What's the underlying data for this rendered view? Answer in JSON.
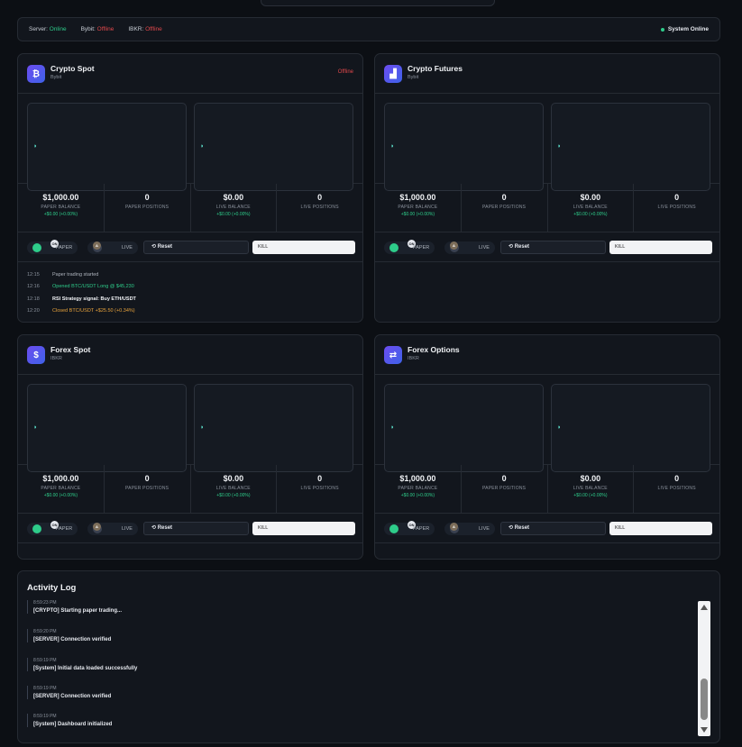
{
  "status_bar": {
    "server_label": "Server:",
    "server_value": "Online",
    "bybit_label": "Bybit:",
    "bybit_value": "Offline",
    "ibkr_label": "IBKR:",
    "ibkr_value": "Offline",
    "system": "System Online"
  },
  "panels": [
    {
      "title": "Crypto Spot",
      "subtitle": "Bybit",
      "status": "Offline",
      "icon": "bitcoin-icon",
      "icon_glyph": "₿",
      "stats": [
        {
          "value": "$1,000.00",
          "label": "PAPER BALANCE",
          "change": "+$0.00 (+0.00%)"
        },
        {
          "value": "0",
          "label": "PAPER POSITIONS",
          "change": ""
        },
        {
          "value": "$0.00",
          "label": "LIVE BALANCE",
          "change": "+$0.00 (+0.00%)"
        },
        {
          "value": "0",
          "label": "LIVE POSITIONS",
          "change": ""
        }
      ],
      "paper_label": "PAPER",
      "paper_tag": "ON",
      "live_label": "LIVE",
      "live_tag": "A",
      "reset_label": "Reset",
      "kill_label": "KILL",
      "trades": [
        {
          "time": "12:15",
          "text": "Paper trading started"
        },
        {
          "time": "12:16",
          "text": "Opened BTC/USDT Long @ $45,230"
        },
        {
          "time": "12:18",
          "text": "RSI Strategy signal: Buy ETH/USDT"
        },
        {
          "time": "12:20",
          "text": "Closed BTC/USDT +$25.50 (+0.34%)"
        }
      ]
    },
    {
      "title": "Crypto Futures",
      "subtitle": "Bybit",
      "status": "",
      "icon": "bar-chart-icon",
      "icon_glyph": "▟",
      "stats": [
        {
          "value": "$1,000.00",
          "label": "PAPER BALANCE",
          "change": "+$0.00 (+0.00%)"
        },
        {
          "value": "0",
          "label": "PAPER POSITIONS",
          "change": ""
        },
        {
          "value": "$0.00",
          "label": "LIVE BALANCE",
          "change": "+$0.00 (+0.00%)"
        },
        {
          "value": "0",
          "label": "LIVE POSITIONS",
          "change": ""
        }
      ],
      "paper_label": "PAPER",
      "paper_tag": "ON",
      "live_label": "LIVE",
      "live_tag": "A",
      "reset_label": "Reset",
      "kill_label": "KILL"
    },
    {
      "title": "Forex Spot",
      "subtitle": "IBKR",
      "status": "",
      "icon": "dollar-icon",
      "icon_glyph": "$",
      "stats": [
        {
          "value": "$1,000.00",
          "label": "PAPER BALANCE",
          "change": "+$0.00 (+0.00%)"
        },
        {
          "value": "0",
          "label": "PAPER POSITIONS",
          "change": ""
        },
        {
          "value": "$0.00",
          "label": "LIVE BALANCE",
          "change": "+$0.00 (+0.00%)"
        },
        {
          "value": "0",
          "label": "LIVE POSITIONS",
          "change": ""
        }
      ],
      "paper_label": "PAPER",
      "paper_tag": "ON",
      "live_label": "LIVE",
      "live_tag": "A",
      "reset_label": "Reset",
      "kill_label": "KILL"
    },
    {
      "title": "Forex Options",
      "subtitle": "IBKR",
      "status": "",
      "icon": "swap-arrows-icon",
      "icon_glyph": "⇄",
      "stats": [
        {
          "value": "$1,000.00",
          "label": "PAPER BALANCE",
          "change": "+$0.00 (+0.00%)"
        },
        {
          "value": "0",
          "label": "PAPER POSITIONS",
          "change": ""
        },
        {
          "value": "$0.00",
          "label": "LIVE BALANCE",
          "change": "+$0.00 (+0.00%)"
        },
        {
          "value": "0",
          "label": "LIVE POSITIONS",
          "change": ""
        }
      ],
      "paper_label": "PAPER",
      "paper_tag": "ON",
      "live_label": "LIVE",
      "live_tag": "A",
      "reset_label": "Reset",
      "kill_label": "KILL"
    }
  ],
  "activity": {
    "title": "Activity Log",
    "entries": [
      {
        "time": "8:59:23 PM",
        "msg": "[CRYPTO] Starting paper trading..."
      },
      {
        "time": "8:59:20 PM",
        "msg": "[SERVER] Connection verified"
      },
      {
        "time": "8:59:19 PM",
        "msg": "[System] Initial data loaded successfully"
      },
      {
        "time": "8:59:19 PM",
        "msg": "[SERVER] Connection verified"
      },
      {
        "time": "8:59:19 PM",
        "msg": "[System] Dashboard initialized"
      }
    ]
  },
  "colors": {
    "online": "#2ecc8a",
    "offline": "#e0484b",
    "accent": "#5b52ee"
  }
}
